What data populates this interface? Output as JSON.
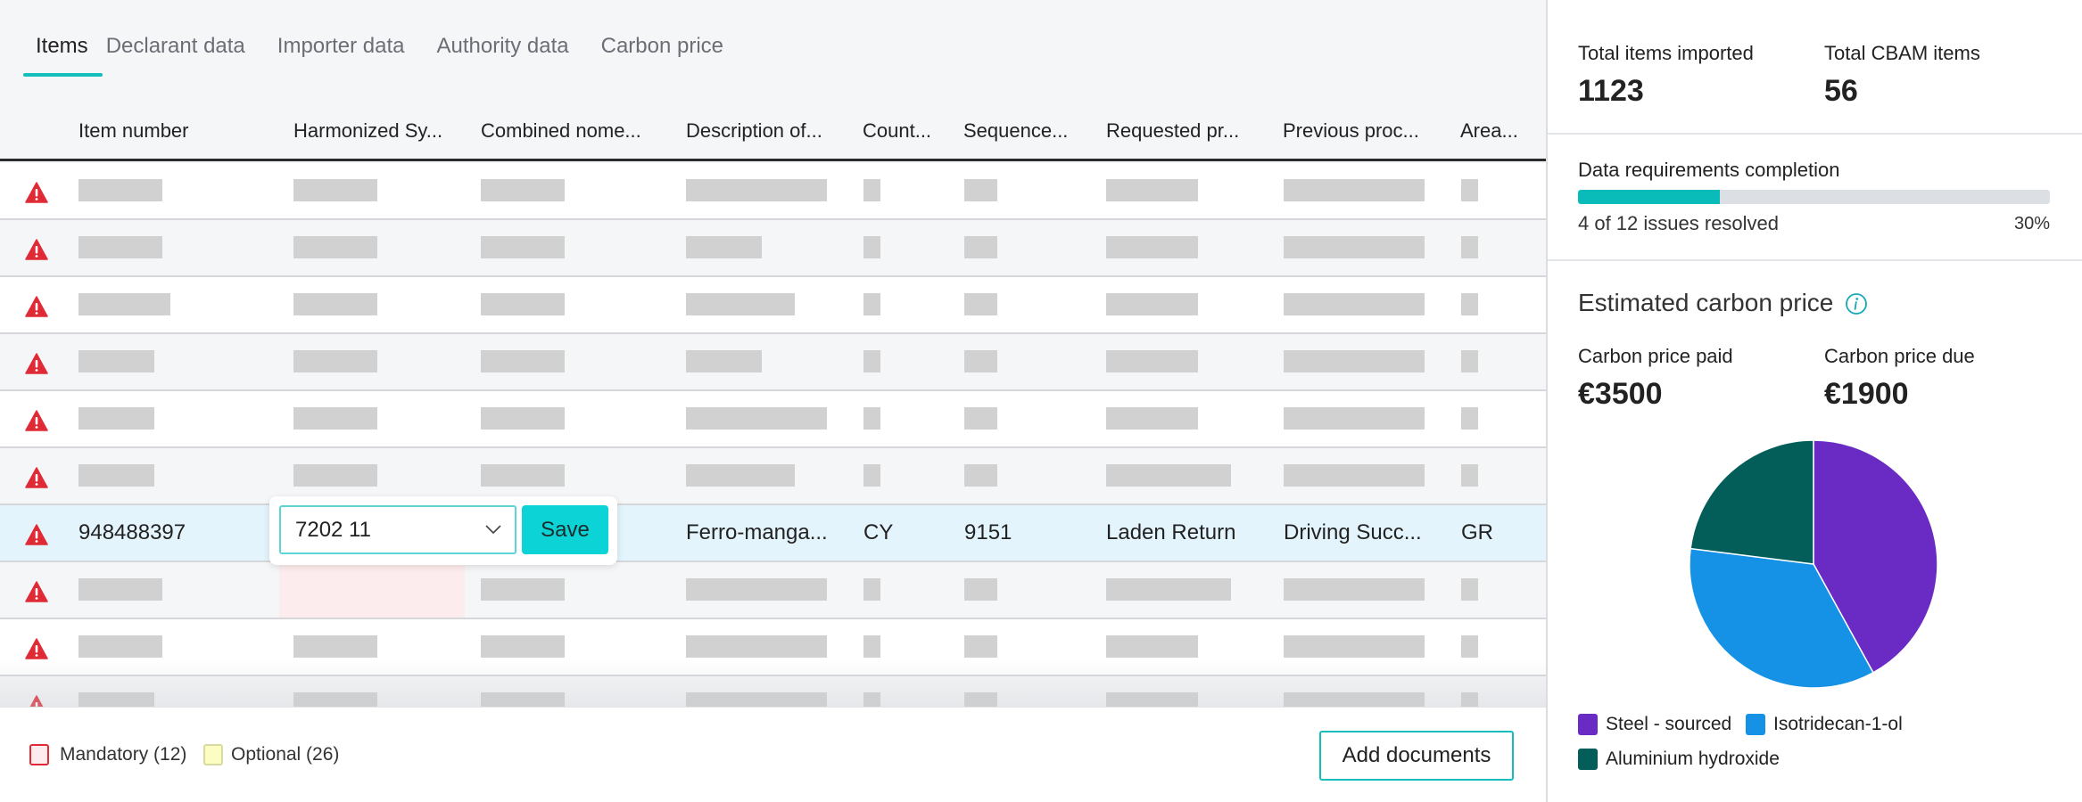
{
  "tabs": [
    {
      "label": "Items",
      "active": true
    },
    {
      "label": "Declarant data",
      "active": false
    },
    {
      "label": "Importer data",
      "active": false
    },
    {
      "label": "Authority data",
      "active": false
    },
    {
      "label": "Carbon price",
      "active": false
    }
  ],
  "table": {
    "columns": [
      "Item number",
      "Harmonized Sy...",
      "Combined nome...",
      "Description of...",
      "Count...",
      "Sequence...",
      "Requested pr...",
      "Previous proc...",
      "Area..."
    ],
    "rows_total_visible": 10,
    "editing_row_index": 6,
    "editing_row": {
      "item_number": "948488397",
      "description": "Ferro-manga...",
      "country": "CY",
      "sequence": "9151",
      "requested_procedure": "Laden Return",
      "previous_procedure": "Driving Succ...",
      "area": "GR"
    },
    "editor": {
      "selected_value": "7202 11",
      "save_label": "Save"
    }
  },
  "footer": {
    "mandatory_label": "Mandatory (12)",
    "optional_label": "Optional (26)",
    "add_documents_label": "Add documents"
  },
  "summary": {
    "total_items_label": "Total items imported",
    "total_items_value": "1123",
    "total_cbam_label": "Total CBAM items",
    "total_cbam_value": "56",
    "completion_label": "Data requirements completion",
    "completion_sub": "4 of 12 issues resolved",
    "completion_pct_label": "30%",
    "completion_fraction": 0.3
  },
  "carbon": {
    "title": "Estimated carbon price",
    "paid_label": "Carbon price paid",
    "paid_value": "€3500",
    "due_label": "Carbon price due",
    "due_value": "€1900"
  },
  "chart_data": {
    "type": "pie",
    "title": "",
    "categories": [
      "Steel - sourced",
      "Isotridecan-1-ol",
      "Aluminium hydroxide"
    ],
    "values": [
      42,
      35,
      23
    ],
    "colors": [
      "#6a2ac4",
      "#1592e6",
      "#035e5a"
    ],
    "legend_position": "bottom"
  },
  "colors": {
    "accent": "#14bfbb",
    "warning": "#e02a35",
    "editing_row": "#e3f4fc"
  }
}
